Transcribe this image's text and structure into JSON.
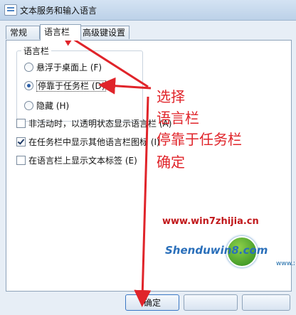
{
  "window": {
    "title": "文本服务和输入语言"
  },
  "tabs": [
    {
      "label": "常规"
    },
    {
      "label": "语言栏"
    },
    {
      "label": "高级键设置"
    }
  ],
  "language_bar": {
    "group_label": "语言栏",
    "options": [
      {
        "label": "悬浮于桌面上 (F)",
        "selected": false
      },
      {
        "label": "停靠于任务栏 (D)",
        "selected": true
      },
      {
        "label": "隐藏 (H)",
        "selected": false
      }
    ]
  },
  "checkboxes": [
    {
      "label": "非活动时，以透明状态显示语言栏 (A)",
      "checked": false
    },
    {
      "label": "在任务栏中显示其他语言栏图标 (I)",
      "checked": true
    },
    {
      "label": "在语言栏上显示文本标签 (E)",
      "checked": false
    }
  ],
  "buttons": {
    "ok": "确定"
  },
  "annotation": {
    "lines": [
      "选择",
      "语言栏",
      "停靠于任务栏",
      "确定"
    ],
    "color": "#e0242a"
  },
  "watermark": {
    "url": "www.win7zhijia.cn",
    "logo_text": "Shenduwin8.com",
    "logo_sub": "www.xxfuyx.com"
  },
  "colors": {
    "accent": "#3b78c4",
    "window_bg": "#e7eef6"
  }
}
